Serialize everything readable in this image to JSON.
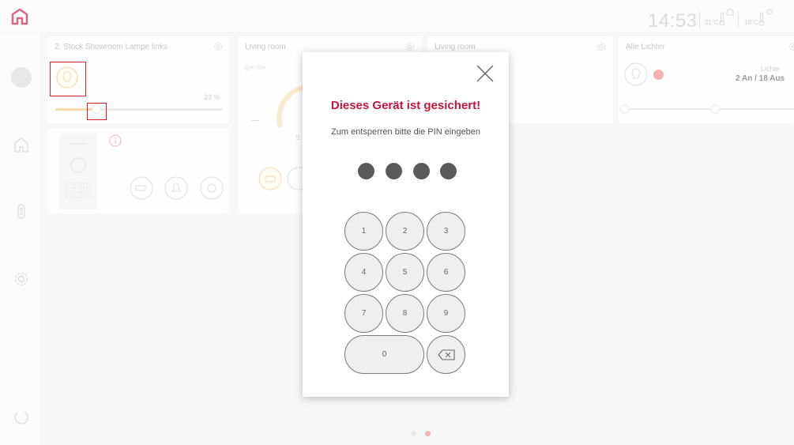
{
  "header": {
    "time": "14:53",
    "temp_inside": "21°C",
    "temp_outside": "18°C"
  },
  "tiles": {
    "lamp": {
      "title": "2. Stock Showroom Lampe links",
      "percent": "23 %",
      "level": 0.23
    },
    "living1": {
      "title": "Living room",
      "label_s": "S"
    },
    "living2": {
      "title": "Living room"
    },
    "alle": {
      "title": "Alle Lichter",
      "lichter_label": "Lichte",
      "status": "2 An / 18 Aus"
    }
  },
  "modal": {
    "title": "Dieses Gerät ist gesichert!",
    "subtitle": "Zum entsperren bitte die PIN eingeben",
    "keys": [
      "1",
      "2",
      "3",
      "4",
      "5",
      "6",
      "7",
      "8",
      "9",
      "0"
    ]
  },
  "colors": {
    "accent": "#c4163c",
    "lamp_yellow": "#f2c98a",
    "alert_red": "#f08a8a",
    "pin_dot": "#5a5a5a"
  },
  "icons": {
    "close": "close-icon",
    "backspace": "backspace-icon",
    "home": "home-icon",
    "settings": "gear-icon"
  }
}
